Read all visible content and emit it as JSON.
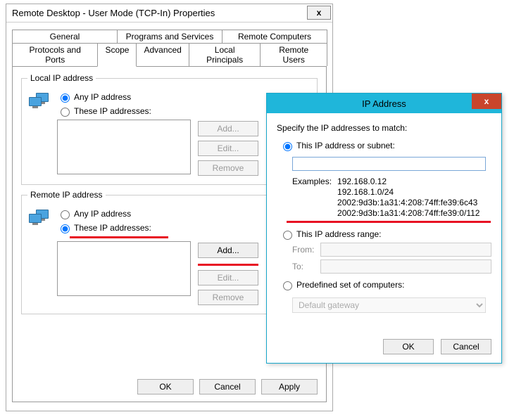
{
  "props": {
    "title": "Remote Desktop - User Mode (TCP-In) Properties",
    "close": "x",
    "tabs_row1": [
      "General",
      "Programs and Services",
      "Remote Computers"
    ],
    "tabs_row2": [
      "Protocols and Ports",
      "Scope",
      "Advanced",
      "Local Principals",
      "Remote Users"
    ],
    "active_tab": "Scope",
    "local": {
      "legend": "Local IP address",
      "any_label": "Any IP address",
      "these_label": "These IP addresses:",
      "add": "Add...",
      "edit": "Edit...",
      "remove": "Remove"
    },
    "remote": {
      "legend": "Remote IP address",
      "any_label": "Any IP address",
      "these_label": "These IP addresses:",
      "add": "Add...",
      "edit": "Edit...",
      "remove": "Remove"
    },
    "buttons": {
      "ok": "OK",
      "cancel": "Cancel",
      "apply": "Apply"
    }
  },
  "ipdlg": {
    "title": "IP Address",
    "close": "x",
    "hint": "Specify the IP addresses to match:",
    "opt_subnet": "This IP address or subnet:",
    "subnet_value": "",
    "examples_label": "Examples:",
    "examples": [
      "192.168.0.12",
      "192.168.1.0/24",
      "2002:9d3b:1a31:4:208:74ff:fe39:6c43",
      "2002:9d3b:1a31:4:208:74ff:fe39:0/112"
    ],
    "opt_range": "This IP address range:",
    "from_label": "From:",
    "to_label": "To:",
    "opt_predef": "Predefined set of computers:",
    "predef_value": "Default gateway",
    "ok": "OK",
    "cancel": "Cancel"
  }
}
